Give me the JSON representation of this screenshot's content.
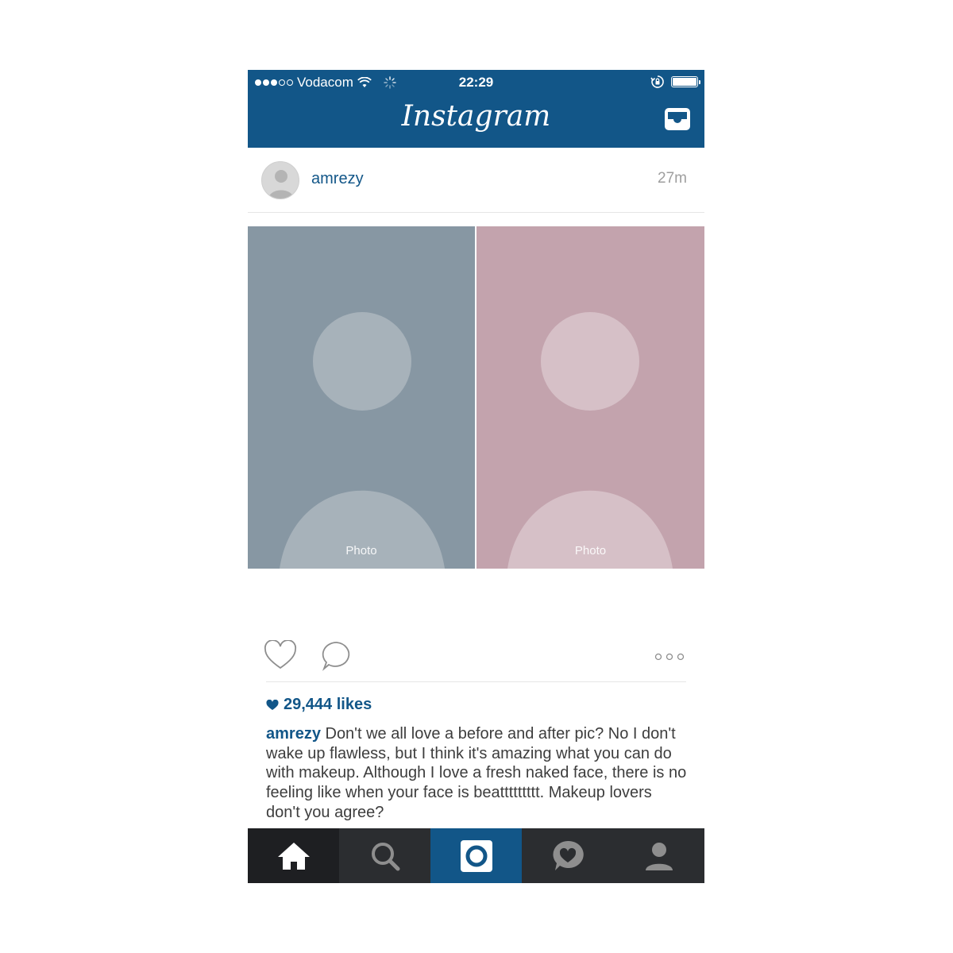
{
  "colors": {
    "brand": "#125688",
    "username": "#125688",
    "timeago": "#9e9e9e",
    "tabbar": "#2b2d30"
  },
  "status_bar": {
    "carrier": "Vodacom",
    "time": "22:29",
    "signal_bars": 3,
    "signal_total": 5
  },
  "header": {
    "logo": "Instagram",
    "inbox_icon": "inbox-tray-icon"
  },
  "post": {
    "username": "amrezy",
    "time_ago": "27m",
    "likes": "29,444 likes",
    "caption_user": "amrezy",
    "caption_text": " Don't we all love a before and after pic? No I don't wake up flawless, but I think it's amazing what you can do with makeup. Although I love a fresh naked face, there is no feeling like when your face is beattttttttt. Makeup lovers don't you agree?"
  },
  "actions": {
    "like_icon": "heart-outline-icon",
    "comment_icon": "comment-bubble-icon",
    "more_icon": "more-dots-icon"
  },
  "tabs": [
    {
      "name": "home",
      "icon": "home-icon"
    },
    {
      "name": "search",
      "icon": "search-icon"
    },
    {
      "name": "camera",
      "icon": "camera-icon"
    },
    {
      "name": "activity",
      "icon": "activity-heart-bubble-icon"
    },
    {
      "name": "profile",
      "icon": "profile-icon"
    }
  ]
}
